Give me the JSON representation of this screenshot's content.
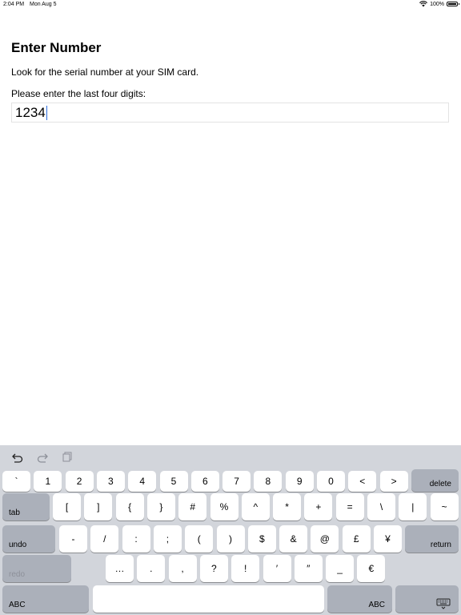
{
  "status_bar": {
    "time": "2:04 PM",
    "date": "Mon Aug 5",
    "battery": "100%"
  },
  "page": {
    "title": "Enter Number",
    "hint": "Look for the serial number at your SIM card.",
    "prompt": "Please enter the last four digits:",
    "input_value": "1234"
  },
  "keyboard": {
    "row1": [
      "`",
      "1",
      "2",
      "3",
      "4",
      "5",
      "6",
      "7",
      "8",
      "9",
      "0",
      "<",
      ">"
    ],
    "delete": "delete",
    "tab": "tab",
    "row2": [
      "[",
      "]",
      "{",
      "}",
      "#",
      "%",
      "^",
      "*",
      "+",
      "=",
      "\\",
      "|",
      "~"
    ],
    "undo": "undo",
    "row3": [
      "-",
      "/",
      ":",
      ";",
      "(",
      ")",
      "$",
      "&",
      "@",
      "£",
      "¥"
    ],
    "return": "return",
    "redo": "redo",
    "row4": [
      "…",
      ".",
      ",",
      "?",
      "!",
      "′",
      "″",
      "_",
      "€"
    ],
    "abc_left": "ABC",
    "abc_right": "ABC"
  }
}
